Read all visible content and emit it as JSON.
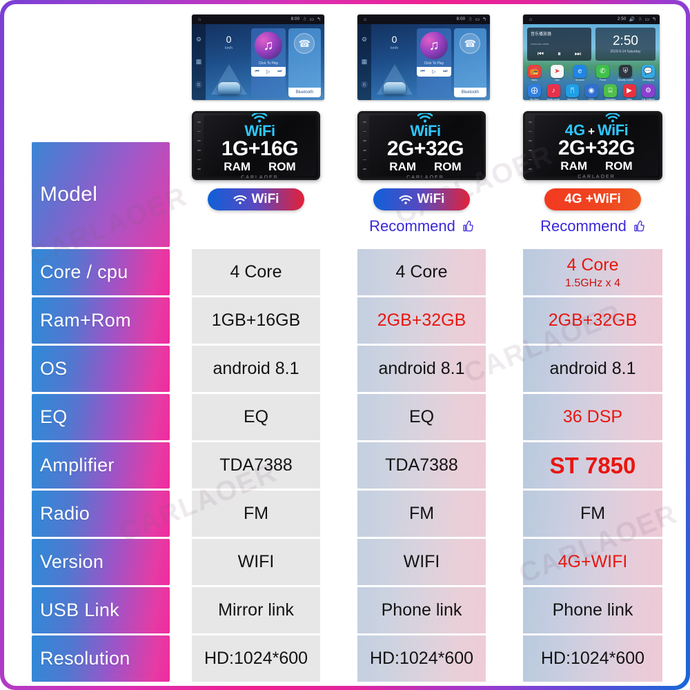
{
  "watermark": {
    "text": "CARLAOER"
  },
  "brand": "CARLAOER",
  "theme": {
    "border_gradient_start": "#7b3fd4",
    "border_gradient_mid": "#f0208f",
    "border_gradient_end": "#1668d8",
    "label_gradient_start": "#2f8ad8",
    "label_gradient_end": "#f02a9e",
    "highlight_red": "#e8160f",
    "recommend_blue": "#3b27d8"
  },
  "spec_labels": [
    "Model",
    "Core / cpu",
    "Ram+Rom",
    "OS",
    "EQ",
    "Amplifier",
    "Radio",
    "Version",
    "USB Link",
    "Resolution"
  ],
  "screens": {
    "a": {
      "statusbar": {
        "time": "8:00",
        "icons": [
          "bluetooth-icon",
          "user-icon",
          "window-icon",
          "back-icon"
        ]
      },
      "rail": [
        "settings-icon",
        "apps-icon",
        "android-icon"
      ],
      "speed": {
        "value": "0",
        "unit": "km/h"
      },
      "music": {
        "caption": "Click To Play",
        "prev": "⏮",
        "play": "▷",
        "next": "⏭"
      },
      "bluetooth": {
        "label": "Bluetooth"
      }
    },
    "b": {
      "statusbar": {
        "time": "2:50",
        "icons": [
          "signal-icon",
          "volume-icon",
          "user-icon",
          "window-icon",
          "back-icon"
        ]
      },
      "player": {
        "title": "音乐播放器",
        "subtitle": "Unknown artist",
        "prev": "⏮",
        "pause": "⏸",
        "next": "⏭"
      },
      "clock": {
        "time": "2:50",
        "date": "2019-9-14  Saturday"
      },
      "apps_row1": [
        {
          "name": "radio-app",
          "label": "Radio",
          "glyph": "📻",
          "color": "#e8413f"
        },
        {
          "name": "maps-app",
          "label": "Navi",
          "glyph": "➤",
          "color": "#f7f7f7"
        },
        {
          "name": "browser-app",
          "label": "Browser",
          "glyph": "e",
          "color": "#1f86e8"
        },
        {
          "name": "phone-app",
          "label": "Phone",
          "glyph": "✆",
          "color": "#3fc04a"
        },
        {
          "name": "security-app",
          "label": "Security Center",
          "glyph": "⛨",
          "color": "#2d3640"
        },
        {
          "name": "messaging-app",
          "label": "Messaging",
          "glyph": "💬",
          "color": "#34a9e8"
        }
      ],
      "apps_row2": [
        {
          "name": "bluetooth-music-app",
          "label": "My Own",
          "glyph": "⨁",
          "color": "#2f7fe0"
        },
        {
          "name": "music-app",
          "label": "Audio music",
          "glyph": "♪",
          "color": "#e8314b"
        },
        {
          "name": "bluetooth-app",
          "label": "Bluetooth",
          "glyph": "ᛗ",
          "color": "#1f9fe8"
        },
        {
          "name": "dvd-app",
          "label": "DVD",
          "glyph": "◉",
          "color": "#2f6fd0"
        },
        {
          "name": "calculator-app",
          "label": "Calculator",
          "glyph": "⌸",
          "color": "#4fc04a"
        },
        {
          "name": "video-app",
          "label": "Video",
          "glyph": "▶",
          "color": "#e8313f"
        },
        {
          "name": "settings-app",
          "label": "Car Settings",
          "glyph": "⚙",
          "color": "#8a3fd0"
        }
      ]
    }
  },
  "columns": [
    {
      "id": "col-1",
      "unit": {
        "network_label": "WiFi",
        "has_4g": false,
        "capacity": "1G+16G",
        "ram_label": "RAM",
        "rom_label": "ROM",
        "brand": "CARLAOER"
      },
      "badge": {
        "label": "WiFi",
        "style": "wifi"
      },
      "recommend": null,
      "specs": {
        "core": "4 Core",
        "core_sub": "",
        "ram_rom": "1GB+16GB",
        "os": "android 8.1",
        "eq": "EQ",
        "amplifier": "TDA7388",
        "radio": "FM",
        "version": "WIFI",
        "usb_link": "Mirror link",
        "resolution": "HD:1024*600"
      },
      "highlight": {
        "core": false,
        "ram_rom": false,
        "os": false,
        "eq": false,
        "amplifier": false,
        "radio": false,
        "version": false,
        "usb_link": false,
        "resolution": false
      }
    },
    {
      "id": "col-2",
      "unit": {
        "network_label": "WiFi",
        "has_4g": false,
        "capacity": "2G+32G",
        "ram_label": "RAM",
        "rom_label": "ROM",
        "brand": "CARLAOER"
      },
      "badge": {
        "label": "WiFi",
        "style": "wifi"
      },
      "recommend": "Recommend",
      "specs": {
        "core": "4 Core",
        "core_sub": "",
        "ram_rom": "2GB+32GB",
        "os": "android 8.1",
        "eq": "EQ",
        "amplifier": "TDA7388",
        "radio": "FM",
        "version": "WIFI",
        "usb_link": "Phone link",
        "resolution": "HD:1024*600"
      },
      "highlight": {
        "core": false,
        "ram_rom": true,
        "os": false,
        "eq": false,
        "amplifier": false,
        "radio": false,
        "version": false,
        "usb_link": false,
        "resolution": false
      }
    },
    {
      "id": "col-3",
      "unit": {
        "network_label": "WiFi",
        "has_4g": true,
        "four_g_label": "4G",
        "plus": "+",
        "capacity": "2G+32G",
        "ram_label": "RAM",
        "rom_label": "ROM",
        "brand": "CARLAOER"
      },
      "badge": {
        "label": "4G +WiFi",
        "style": "4g"
      },
      "recommend": "Recommend",
      "specs": {
        "core": "4 Core",
        "core_sub": "1.5GHz x 4",
        "ram_rom": "2GB+32GB",
        "os": "android 8.1",
        "eq": "36 DSP",
        "amplifier": "ST 7850",
        "radio": "FM",
        "version": "4G+WIFI",
        "usb_link": "Phone link",
        "resolution": "HD:1024*600"
      },
      "highlight": {
        "core": true,
        "ram_rom": true,
        "os": false,
        "eq": true,
        "amplifier": true,
        "radio": false,
        "version": true,
        "usb_link": false,
        "resolution": false
      }
    }
  ]
}
